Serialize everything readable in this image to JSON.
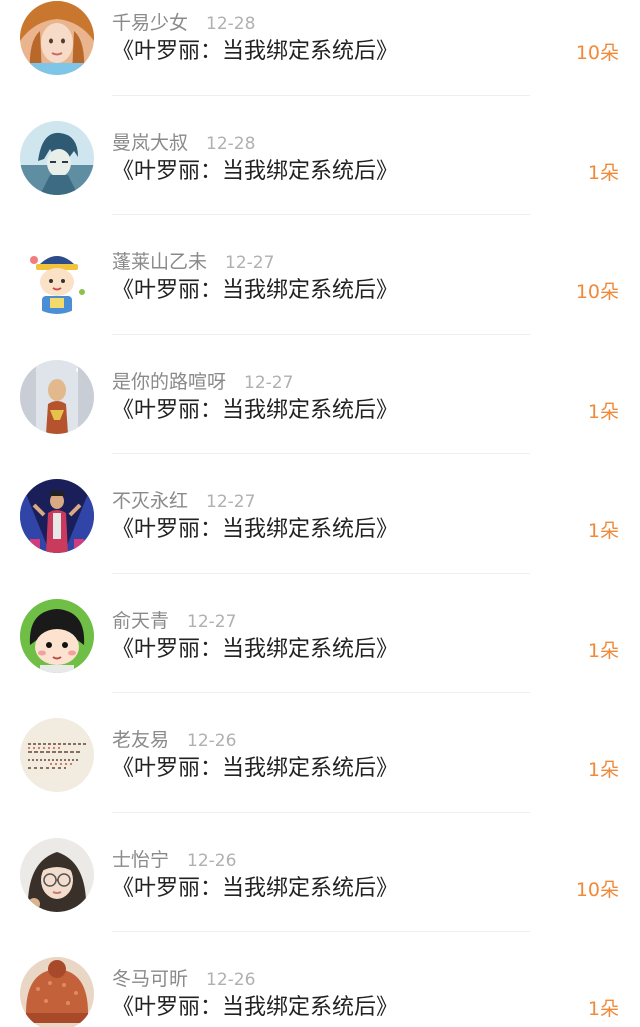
{
  "colors": {
    "accent": "#f08a3a",
    "name_gray": "#8a8a8a",
    "date_gray": "#b0b0b0",
    "title_black": "#222222"
  },
  "items": [
    {
      "user": "千易少女",
      "date": "12-28",
      "title": "《叶罗丽：当我绑定系统后》",
      "gift": "10朵",
      "avatar_icon": "girl-avatar-icon"
    },
    {
      "user": "曼岚大叔",
      "date": "12-28",
      "title": "《叶罗丽：当我绑定系统后》",
      "gift": "1朵",
      "avatar_icon": "anime-boy-avatar-icon"
    },
    {
      "user": "蓬莱山乙未",
      "date": "12-27",
      "title": "《叶罗丽：当我绑定系统后》",
      "gift": "10朵",
      "avatar_icon": "cartoon-character-avatar-icon"
    },
    {
      "user": "是你的路喧呀",
      "date": "12-27",
      "title": "《叶罗丽：当我绑定系统后》",
      "gift": "1朵",
      "avatar_icon": "snowy-figure-avatar-icon"
    },
    {
      "user": "不灭永红",
      "date": "12-27",
      "title": "《叶罗丽：当我绑定系统后》",
      "gift": "1朵",
      "avatar_icon": "stage-performer-avatar-icon"
    },
    {
      "user": "俞天青",
      "date": "12-27",
      "title": "《叶罗丽：当我绑定系统后》",
      "gift": "1朵",
      "avatar_icon": "cartoon-girl-avatar-icon"
    },
    {
      "user": "老友易",
      "date": "12-26",
      "title": "《叶罗丽：当我绑定系统后》",
      "gift": "1朵",
      "avatar_icon": "handwriting-avatar-icon"
    },
    {
      "user": "士怡宁",
      "date": "12-26",
      "title": "《叶罗丽：当我绑定系统后》",
      "gift": "10朵",
      "avatar_icon": "glasses-girl-avatar-icon"
    },
    {
      "user": "冬马可昕",
      "date": "12-26",
      "title": "《叶罗丽：当我绑定系统后》",
      "gift": "1朵",
      "avatar_icon": "knit-hat-avatar-icon"
    }
  ]
}
